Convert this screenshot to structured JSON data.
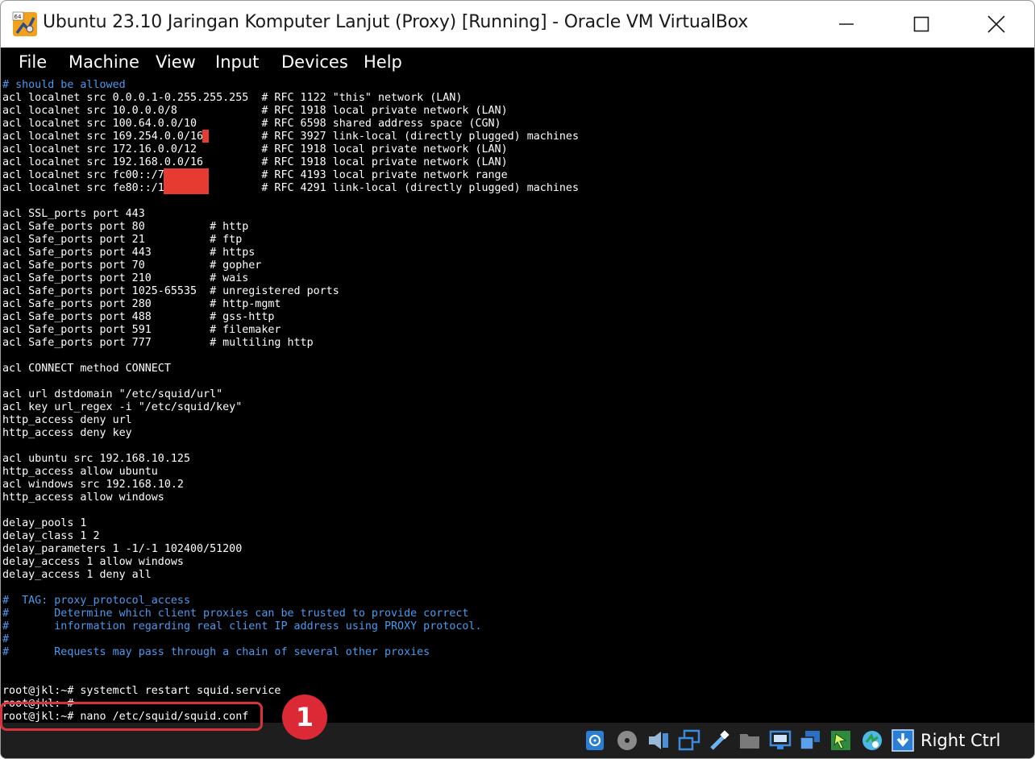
{
  "window": {
    "title": "Ubuntu 23.10 Jaringan Komputer Lanjut (Proxy) [Running] - Oracle VM VirtualBox",
    "app_icon_badge": "64"
  },
  "menubar": {
    "items": [
      {
        "label": "File"
      },
      {
        "label": "Machine"
      },
      {
        "label": "View"
      },
      {
        "label": "Input"
      },
      {
        "label": "Devices"
      },
      {
        "label": "Help"
      }
    ]
  },
  "terminal": {
    "lines": [
      {
        "text": "# should be allowed",
        "comment": true
      },
      {
        "text": "acl localnet src 0.0.0.1-0.255.255.255  # RFC 1122 \"this\" network (LAN)"
      },
      {
        "text": "acl localnet src 10.0.0.0/8             # RFC 1918 local private network (LAN)"
      },
      {
        "text": "acl localnet src 100.64.0.0/10          # RFC 6598 shared address space (CGN)"
      },
      {
        "text": "acl localnet src 169.254.0.0/16         # RFC 3927 link-local (directly plugged) machines"
      },
      {
        "text": "acl localnet src 172.16.0.0/12          # RFC 1918 local private network (LAN)"
      },
      {
        "text": "acl localnet src 192.168.0.0/16         # RFC 1918 local private network (LAN)"
      },
      {
        "text": "acl localnet src fc00::/7               # RFC 4193 local private network range"
      },
      {
        "text": "acl localnet src fe80::/10              # RFC 4291 link-local (directly plugged) machines"
      },
      {
        "text": ""
      },
      {
        "text": "acl SSL_ports port 443"
      },
      {
        "text": "acl Safe_ports port 80          # http"
      },
      {
        "text": "acl Safe_ports port 21          # ftp"
      },
      {
        "text": "acl Safe_ports port 443         # https"
      },
      {
        "text": "acl Safe_ports port 70          # gopher"
      },
      {
        "text": "acl Safe_ports port 210         # wais"
      },
      {
        "text": "acl Safe_ports port 1025-65535  # unregistered ports"
      },
      {
        "text": "acl Safe_ports port 280         # http-mgmt"
      },
      {
        "text": "acl Safe_ports port 488         # gss-http"
      },
      {
        "text": "acl Safe_ports port 591         # filemaker"
      },
      {
        "text": "acl Safe_ports port 777         # multiling http"
      },
      {
        "text": ""
      },
      {
        "text": "acl CONNECT method CONNECT"
      },
      {
        "text": ""
      },
      {
        "text": "acl url dstdomain \"/etc/squid/url\""
      },
      {
        "text": "acl key url_regex -i \"/etc/squid/key\""
      },
      {
        "text": "http_access deny url"
      },
      {
        "text": "http_access deny key"
      },
      {
        "text": ""
      },
      {
        "text": "acl ubuntu src 192.168.10.125"
      },
      {
        "text": "http_access allow ubuntu"
      },
      {
        "text": "acl windows src 192.168.10.2"
      },
      {
        "text": "http_access allow windows"
      },
      {
        "text": ""
      },
      {
        "text": "delay_pools 1"
      },
      {
        "text": "delay_class 1 2"
      },
      {
        "text": "delay_parameters 1 -1/-1 102400/51200"
      },
      {
        "text": "delay_access 1 allow windows"
      },
      {
        "text": "delay_access 1 deny all"
      },
      {
        "text": ""
      },
      {
        "text": "#  TAG: proxy_protocol_access",
        "comment": true
      },
      {
        "text": "#       Determine which client proxies can be trusted to provide correct",
        "comment": true
      },
      {
        "text": "#       information regarding real client IP address using PROXY protocol.",
        "comment": true
      },
      {
        "text": "#",
        "comment": true
      },
      {
        "text": "#       Requests may pass through a chain of several other proxies",
        "comment": true
      },
      {
        "text": ""
      },
      {
        "text": ""
      },
      {
        "text": "root@jkl:~# systemctl restart squid.service"
      },
      {
        "text": "root@jkl:~#"
      },
      {
        "text": "root@jkl:~# nano /etc/squid/squid.conf"
      }
    ]
  },
  "annotation": {
    "step_number": "1",
    "color": "#db2a36"
  },
  "statusbar": {
    "host_key": "Right Ctrl",
    "icons": [
      "hard-disk-icon",
      "optical-drive-icon",
      "audio-icon",
      "network-icon",
      "usb-icon",
      "shared-folders-icon",
      "display-icon",
      "recording-icon",
      "mouse-integration-icon",
      "cpu-activity-icon",
      "keyboard-capture-icon"
    ]
  },
  "colors": {
    "terminal_bg": "#000000",
    "terminal_fg": "#ffffff",
    "comment": "#4a9bf0",
    "redaction": "#e53b30"
  }
}
